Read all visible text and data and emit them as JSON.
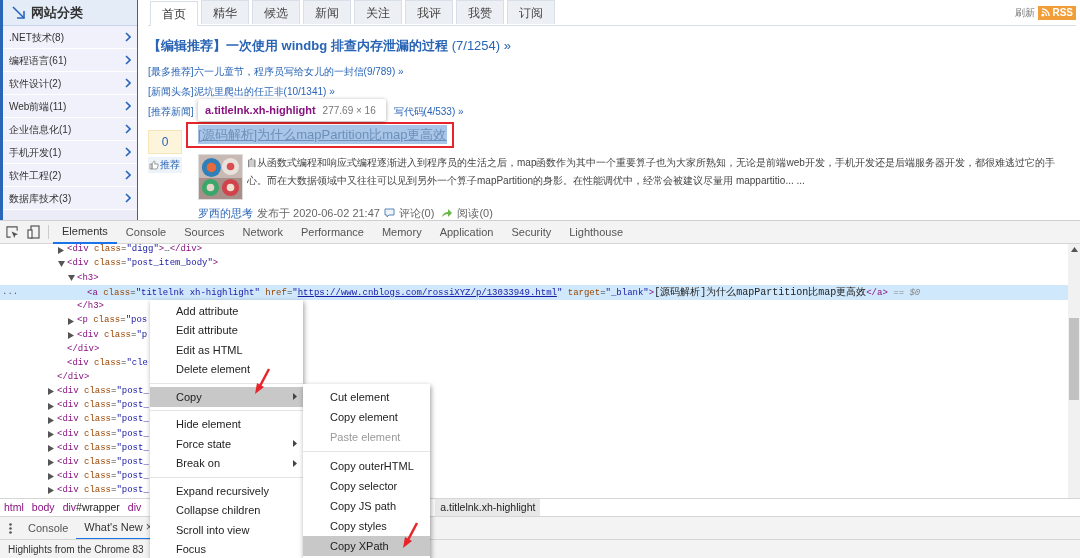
{
  "sidebar": {
    "title": "网站分类",
    "items": [
      {
        "label": ".NET技术(8)"
      },
      {
        "label": "编程语言(61)"
      },
      {
        "label": "软件设计(2)"
      },
      {
        "label": "Web前端(11)"
      },
      {
        "label": "企业信息化(1)"
      },
      {
        "label": "手机开发(1)"
      },
      {
        "label": "软件工程(2)"
      },
      {
        "label": "数据库技术(3)"
      }
    ]
  },
  "tabs": [
    {
      "label": "首页",
      "selected": true
    },
    {
      "label": "精华",
      "selected": false
    },
    {
      "label": "候选",
      "selected": false
    },
    {
      "label": "新闻",
      "selected": false
    },
    {
      "label": "关注",
      "selected": false
    },
    {
      "label": "我评",
      "selected": false
    },
    {
      "label": "我赞",
      "selected": false
    },
    {
      "label": "订阅",
      "selected": false
    }
  ],
  "refresh": "刷新",
  "rss": "RSS",
  "headline": {
    "title": "【编辑推荐】一次使用 windbg 排查内存泄漏的过程",
    "count": "(7/1254) »"
  },
  "news": [
    {
      "text": "[最多推荐]六一儿童节，程序员写给女儿的一封信(9/789) »"
    },
    {
      "text": "[新闻头条]泥坑里爬出的任正非(10/1341) »"
    },
    {
      "text": "[推荐新闻]",
      "continued": "写代码(4/533) »"
    }
  ],
  "post": {
    "digg_count": "0",
    "digg_label": "推荐",
    "title": "[源码解析]为什么mapPartition比map更高效",
    "summary": "自从函数式编程和响应式编程逐渐进入到程序员的生活之后，map函数作为其中一个重要算子也为大家所熟知，无论是前端web开发，手机开发还是后端服务器开发，都很难逃过它的手心。而在大数据领域中又往往可以见到另外一个算子mapPartition的身影。在性能调优中，经常会被建议尽量用 mappartitio... ...",
    "author": "罗西的思考",
    "posted": "发布于 2020-06-02 21:47",
    "comments": "评论(0)",
    "reads": "阅读(0)"
  },
  "tooltip": {
    "selector": "a.titlelnk.xh-highlight",
    "size": "277.69 × 16"
  },
  "devtools": {
    "tabs": [
      {
        "label": "Elements",
        "selected": true
      },
      {
        "label": "Console",
        "selected": false
      },
      {
        "label": "Sources",
        "selected": false
      },
      {
        "label": "Network",
        "selected": false
      },
      {
        "label": "Performance",
        "selected": false
      },
      {
        "label": "Memory",
        "selected": false
      },
      {
        "label": "Application",
        "selected": false
      },
      {
        "label": "Security",
        "selected": false
      },
      {
        "label": "Lighthouse",
        "selected": false
      }
    ],
    "tree": [
      {
        "children": [
          {
            "expanded": false,
            "tokens": [
              {
                "kind": "tag",
                "text": "<div"
              },
              {
                "kind": "attr",
                "text": " class"
              },
              {
                "kind": "punct",
                "text": "="
              },
              {
                "kind": "value",
                "text": "\"digg\""
              },
              {
                "kind": "tag",
                "text": ">"
              },
              {
                "kind": "punct",
                "text": "…"
              },
              {
                "kind": "tag",
                "text": "</div>"
              }
            ]
          },
          {
            "expanded": true,
            "tokens": [
              {
                "kind": "tag",
                "text": "<div"
              },
              {
                "kind": "attr",
                "text": " class"
              },
              {
                "kind": "punct",
                "text": "="
              },
              {
                "kind": "value",
                "text": "\"post_item_body\""
              },
              {
                "kind": "tag",
                "text": ">"
              }
            ],
            "children": [
              {
                "expanded": true,
                "tokens": [
                  {
                    "kind": "tag",
                    "text": "<h3>"
                  }
                ],
                "children": [
                  {
                    "selected": true,
                    "dots": "...",
                    "tokens": [
                      {
                        "kind": "tag",
                        "text": "<a"
                      },
                      {
                        "kind": "attr",
                        "text": " class"
                      },
                      {
                        "kind": "punct",
                        "text": "="
                      },
                      {
                        "kind": "value",
                        "text": "\"titlelnk xh-highlight\""
                      },
                      {
                        "kind": "attr",
                        "text": " href"
                      },
                      {
                        "kind": "punct",
                        "text": "="
                      },
                      {
                        "kind": "value",
                        "text": "\""
                      },
                      {
                        "kind": "link",
                        "text": "https://www.cnblogs.com/rossiXYZ/p/13033949.html"
                      },
                      {
                        "kind": "value",
                        "text": "\""
                      },
                      {
                        "kind": "attr",
                        "text": " target"
                      },
                      {
                        "kind": "punct",
                        "text": "="
                      },
                      {
                        "kind": "value",
                        "text": "\"_blank\""
                      },
                      {
                        "kind": "tag",
                        "text": ">"
                      },
                      {
                        "kind": "text",
                        "text": "[源码解析]为什么mapPartition比map更高效"
                      },
                      {
                        "kind": "tag",
                        "text": "</a>"
                      },
                      {
                        "kind": "comment",
                        "text": " == $0"
                      }
                    ]
                  }
                ],
                "close": [
                  {
                    "kind": "tag",
                    "text": "</h3>"
                  }
                ]
              },
              {
                "expanded": false,
                "tokens": [
                  {
                    "kind": "tag",
                    "text": "<p"
                  },
                  {
                    "kind": "attr",
                    "text": " class"
                  },
                  {
                    "kind": "punct",
                    "text": "="
                  },
                  {
                    "kind": "value",
                    "text": "\"pos"
                  }
                ]
              },
              {
                "expanded": false,
                "tokens": [
                  {
                    "kind": "tag",
                    "text": "<div"
                  },
                  {
                    "kind": "attr",
                    "text": " class"
                  },
                  {
                    "kind": "punct",
                    "text": "="
                  },
                  {
                    "kind": "value",
                    "text": "\"p"
                  }
                ]
              }
            ],
            "close": [
              {
                "kind": "tag",
                "text": "</div>"
              }
            ]
          },
          {
            "tokens": [
              {
                "kind": "tag",
                "text": "<div"
              },
              {
                "kind": "attr",
                "text": " class"
              },
              {
                "kind": "punct",
                "text": "="
              },
              {
                "kind": "value",
                "text": "\"cle"
              }
            ]
          }
        ],
        "close": [
          {
            "kind": "tag",
            "text": "</div>"
          }
        ]
      },
      {
        "expanded": false,
        "tokens": [
          {
            "kind": "tag",
            "text": "<div"
          },
          {
            "kind": "attr",
            "text": " class"
          },
          {
            "kind": "punct",
            "text": "="
          },
          {
            "kind": "value",
            "text": "\"post_"
          }
        ]
      },
      {
        "expanded": false,
        "tokens": [
          {
            "kind": "tag",
            "text": "<div"
          },
          {
            "kind": "attr",
            "text": " class"
          },
          {
            "kind": "punct",
            "text": "="
          },
          {
            "kind": "value",
            "text": "\"post_"
          }
        ]
      },
      {
        "expanded": false,
        "tokens": [
          {
            "kind": "tag",
            "text": "<div"
          },
          {
            "kind": "attr",
            "text": " class"
          },
          {
            "kind": "punct",
            "text": "="
          },
          {
            "kind": "value",
            "text": "\"post_"
          }
        ]
      },
      {
        "expanded": false,
        "tokens": [
          {
            "kind": "tag",
            "text": "<div"
          },
          {
            "kind": "attr",
            "text": " class"
          },
          {
            "kind": "punct",
            "text": "="
          },
          {
            "kind": "value",
            "text": "\"post_"
          }
        ]
      },
      {
        "expanded": false,
        "tokens": [
          {
            "kind": "tag",
            "text": "<div"
          },
          {
            "kind": "attr",
            "text": " class"
          },
          {
            "kind": "punct",
            "text": "="
          },
          {
            "kind": "value",
            "text": "\"post_"
          }
        ]
      },
      {
        "expanded": false,
        "tokens": [
          {
            "kind": "tag",
            "text": "<div"
          },
          {
            "kind": "attr",
            "text": " class"
          },
          {
            "kind": "punct",
            "text": "="
          },
          {
            "kind": "value",
            "text": "\"post_"
          }
        ]
      },
      {
        "expanded": false,
        "tokens": [
          {
            "kind": "tag",
            "text": "<div"
          },
          {
            "kind": "attr",
            "text": " class"
          },
          {
            "kind": "punct",
            "text": "="
          },
          {
            "kind": "value",
            "text": "\"post_"
          }
        ]
      },
      {
        "expanded": false,
        "tokens": [
          {
            "kind": "tag",
            "text": "<div"
          },
          {
            "kind": "attr",
            "text": " class"
          },
          {
            "kind": "punct",
            "text": "="
          },
          {
            "kind": "value",
            "text": "\"post_"
          }
        ]
      }
    ],
    "breadcrumbs": [
      {
        "tag": "html",
        "selected": false
      },
      {
        "tag": "body",
        "selected": false
      },
      {
        "tag": "div",
        "rest": "#wrapper",
        "selected": false
      },
      {
        "tag": "div",
        "selected": false
      },
      {
        "tag": "a",
        "rest": ".titlelnk.xh-highlight",
        "selected": true
      }
    ],
    "drawer_tabs": [
      {
        "label": "Console",
        "selected": false
      },
      {
        "label": "What's New",
        "selected": true,
        "close": "×"
      }
    ],
    "drawer_text": "Highlights from the Chrome 83"
  },
  "context_menu": {
    "items": [
      {
        "kind": "item",
        "label": "Add attribute",
        "selected": false,
        "submenu": false
      },
      {
        "kind": "item",
        "label": "Edit attribute",
        "selected": false,
        "submenu": false
      },
      {
        "kind": "item",
        "label": "Edit as HTML",
        "selected": false,
        "submenu": false
      },
      {
        "kind": "item",
        "label": "Delete element",
        "selected": false,
        "submenu": false
      },
      {
        "kind": "separator"
      },
      {
        "kind": "item",
        "label": "Copy",
        "selected": true,
        "submenu": true
      },
      {
        "kind": "separator"
      },
      {
        "kind": "item",
        "label": "Hide element",
        "selected": false,
        "submenu": false
      },
      {
        "kind": "item",
        "label": "Force state",
        "selected": false,
        "submenu": true
      },
      {
        "kind": "item",
        "label": "Break on",
        "selected": false,
        "submenu": true
      },
      {
        "kind": "separator"
      },
      {
        "kind": "item",
        "label": "Expand recursively",
        "selected": false,
        "submenu": false
      },
      {
        "kind": "item",
        "label": "Collapse children",
        "selected": false,
        "submenu": false
      },
      {
        "kind": "item",
        "label": "Scroll into view",
        "selected": false,
        "submenu": false
      },
      {
        "kind": "item",
        "label": "Focus",
        "selected": false,
        "submenu": false
      }
    ],
    "submenu": [
      {
        "kind": "item",
        "label": "Cut element",
        "selected": false,
        "disabled": false
      },
      {
        "kind": "item",
        "label": "Copy element",
        "selected": false,
        "disabled": false
      },
      {
        "kind": "item",
        "label": "Paste element",
        "selected": false,
        "disabled": true
      },
      {
        "kind": "separator"
      },
      {
        "kind": "item",
        "label": "Copy outerHTML",
        "selected": false,
        "disabled": false
      },
      {
        "kind": "item",
        "label": "Copy selector",
        "selected": false,
        "disabled": false
      },
      {
        "kind": "item",
        "label": "Copy JS path",
        "selected": false,
        "disabled": false
      },
      {
        "kind": "item",
        "label": "Copy styles",
        "selected": false,
        "disabled": false
      },
      {
        "kind": "item",
        "label": "Copy XPath",
        "selected": true,
        "disabled": false
      }
    ]
  }
}
